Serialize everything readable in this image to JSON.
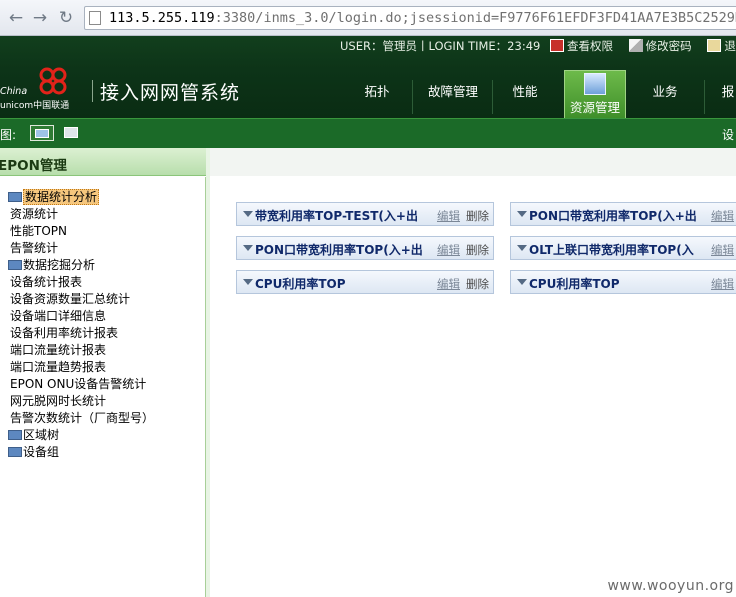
{
  "browser": {
    "url_host": "113.5.255.119",
    "url_rest": ":3380/inms_3.0/login.do;jsessionid=F9776F61EFDF3FD41AA7E3B5C2529D"
  },
  "header": {
    "user_line": "USER：管理员丨LOGIN TIME：23:49",
    "view_rights": "查看权限",
    "change_password": "修改密码",
    "exit_partial": "退",
    "logo_text_1": "China",
    "logo_text_2": "unicom中国联通",
    "app_title": "接入网网管系统",
    "nav": [
      {
        "label": "拓扑"
      },
      {
        "label": "故障管理"
      },
      {
        "label": "性能"
      },
      {
        "label": "资源管理"
      },
      {
        "label": "业务"
      },
      {
        "label": "报"
      }
    ]
  },
  "toolbar": {
    "view_label": "视图:",
    "right_text": "设"
  },
  "sidebar": {
    "title": "EPON管理",
    "items": [
      {
        "label": "数据统计分析",
        "folder": true,
        "selected": true
      },
      {
        "label": "资源统计"
      },
      {
        "label": "性能TOPN"
      },
      {
        "label": "告警统计"
      },
      {
        "label": "数据挖掘分析",
        "folder": true
      },
      {
        "label": "设备统计报表"
      },
      {
        "label": "设备资源数量汇总统计"
      },
      {
        "label": "设备端口详细信息"
      },
      {
        "label": "设备利用率统计报表"
      },
      {
        "label": "端口流量统计报表"
      },
      {
        "label": "端口流量趋势报表"
      },
      {
        "label": "EPON ONU设备告警统计"
      },
      {
        "label": "网元脱网时长统计"
      },
      {
        "label": "告警次数统计（厂商型号）"
      },
      {
        "label": "区域树",
        "folder": true
      },
      {
        "label": "设备组",
        "folder": true
      }
    ]
  },
  "portlets": [
    {
      "title": "带宽利用率TOP-TEST(入+出",
      "edit": "编辑",
      "delete": "删除"
    },
    {
      "title": "PON口带宽利用率TOP(入+出",
      "edit": "编辑"
    },
    {
      "title": "PON口带宽利用率TOP(入+出",
      "edit": "编辑",
      "delete": "删除"
    },
    {
      "title": "OLT上联口带宽利用率TOP(入",
      "edit": "编辑"
    },
    {
      "title": "CPU利用率TOP",
      "edit": "编辑",
      "delete": "删除"
    },
    {
      "title": "CPU利用率TOP",
      "edit": "编辑"
    }
  ],
  "watermark": "www.wooyun.org"
}
